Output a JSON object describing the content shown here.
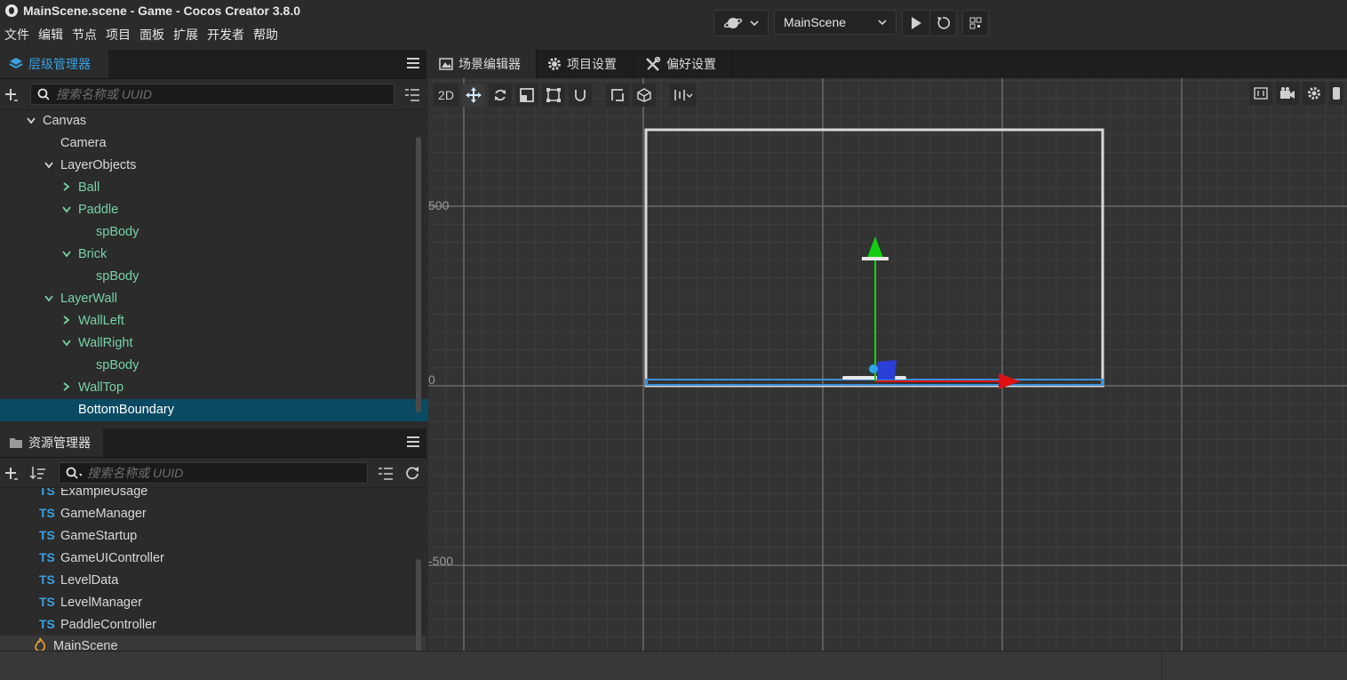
{
  "window": {
    "title": "MainScene.scene - Game - Cocos Creator 3.8.0"
  },
  "menu": [
    "文件",
    "编辑",
    "节点",
    "项目",
    "面板",
    "扩展",
    "开发者",
    "帮助"
  ],
  "toolbar": {
    "scene_select": "MainScene"
  },
  "hierarchy": {
    "title": "层级管理器",
    "search_placeholder": "搜索名称或 UUID",
    "nodes": [
      {
        "label": "Canvas",
        "depth": 1,
        "expander": "v",
        "prefab": false,
        "selected": false
      },
      {
        "label": "Camera",
        "depth": 2,
        "expander": "",
        "prefab": false,
        "selected": false
      },
      {
        "label": "LayerObjects",
        "depth": 2,
        "expander": "v",
        "prefab": false,
        "selected": false
      },
      {
        "label": "Ball",
        "depth": 3,
        "expander": ">",
        "prefab": true,
        "selected": false
      },
      {
        "label": "Paddle",
        "depth": 3,
        "expander": "v",
        "prefab": true,
        "selected": false
      },
      {
        "label": "spBody",
        "depth": 4,
        "expander": "",
        "prefab": true,
        "selected": false
      },
      {
        "label": "Brick",
        "depth": 3,
        "expander": "v",
        "prefab": true,
        "selected": false
      },
      {
        "label": "spBody",
        "depth": 4,
        "expander": "",
        "prefab": true,
        "selected": false
      },
      {
        "label": "LayerWall",
        "depth": 2,
        "expander": "v",
        "prefab": true,
        "selected": false
      },
      {
        "label": "WallLeft",
        "depth": 3,
        "expander": ">",
        "prefab": true,
        "selected": false
      },
      {
        "label": "WallRight",
        "depth": 3,
        "expander": "v",
        "prefab": true,
        "selected": false
      },
      {
        "label": "spBody",
        "depth": 4,
        "expander": "",
        "prefab": true,
        "selected": false
      },
      {
        "label": "WallTop",
        "depth": 3,
        "expander": ">",
        "prefab": true,
        "selected": false
      },
      {
        "label": "BottomBoundary",
        "depth": 3,
        "expander": "",
        "prefab": false,
        "selected": true
      }
    ]
  },
  "assets": {
    "title": "资源管理器",
    "search_placeholder": "搜索名称或 UUID",
    "items": [
      {
        "type": "TS",
        "label": "ExampleUsage"
      },
      {
        "type": "TS",
        "label": "GameManager"
      },
      {
        "type": "TS",
        "label": "GameStartup"
      },
      {
        "type": "TS",
        "label": "GameUIController"
      },
      {
        "type": "TS",
        "label": "LevelData"
      },
      {
        "type": "TS",
        "label": "LevelManager"
      },
      {
        "type": "TS",
        "label": "PaddleController"
      },
      {
        "type": "scene",
        "label": "MainScene"
      }
    ]
  },
  "scene_editor": {
    "tabs": [
      "场景编辑器",
      "项目设置",
      "偏好设置"
    ],
    "mode_label": "2D",
    "ruler_labels": [
      "500",
      "0",
      "-500"
    ]
  },
  "colors": {
    "accent": "#3aa0e0",
    "prefab": "#76d2a6",
    "selection": "#0b4a63",
    "gizmo_x": "#e01010",
    "gizmo_y": "#10d010"
  },
  "icons": {
    "app": "cocos-logo-icon",
    "hierarchy": "layers-icon",
    "assets": "folder-icon",
    "scene": "scene-editor-icon",
    "project_settings": "gear-icon",
    "preferences": "tools-icon"
  }
}
